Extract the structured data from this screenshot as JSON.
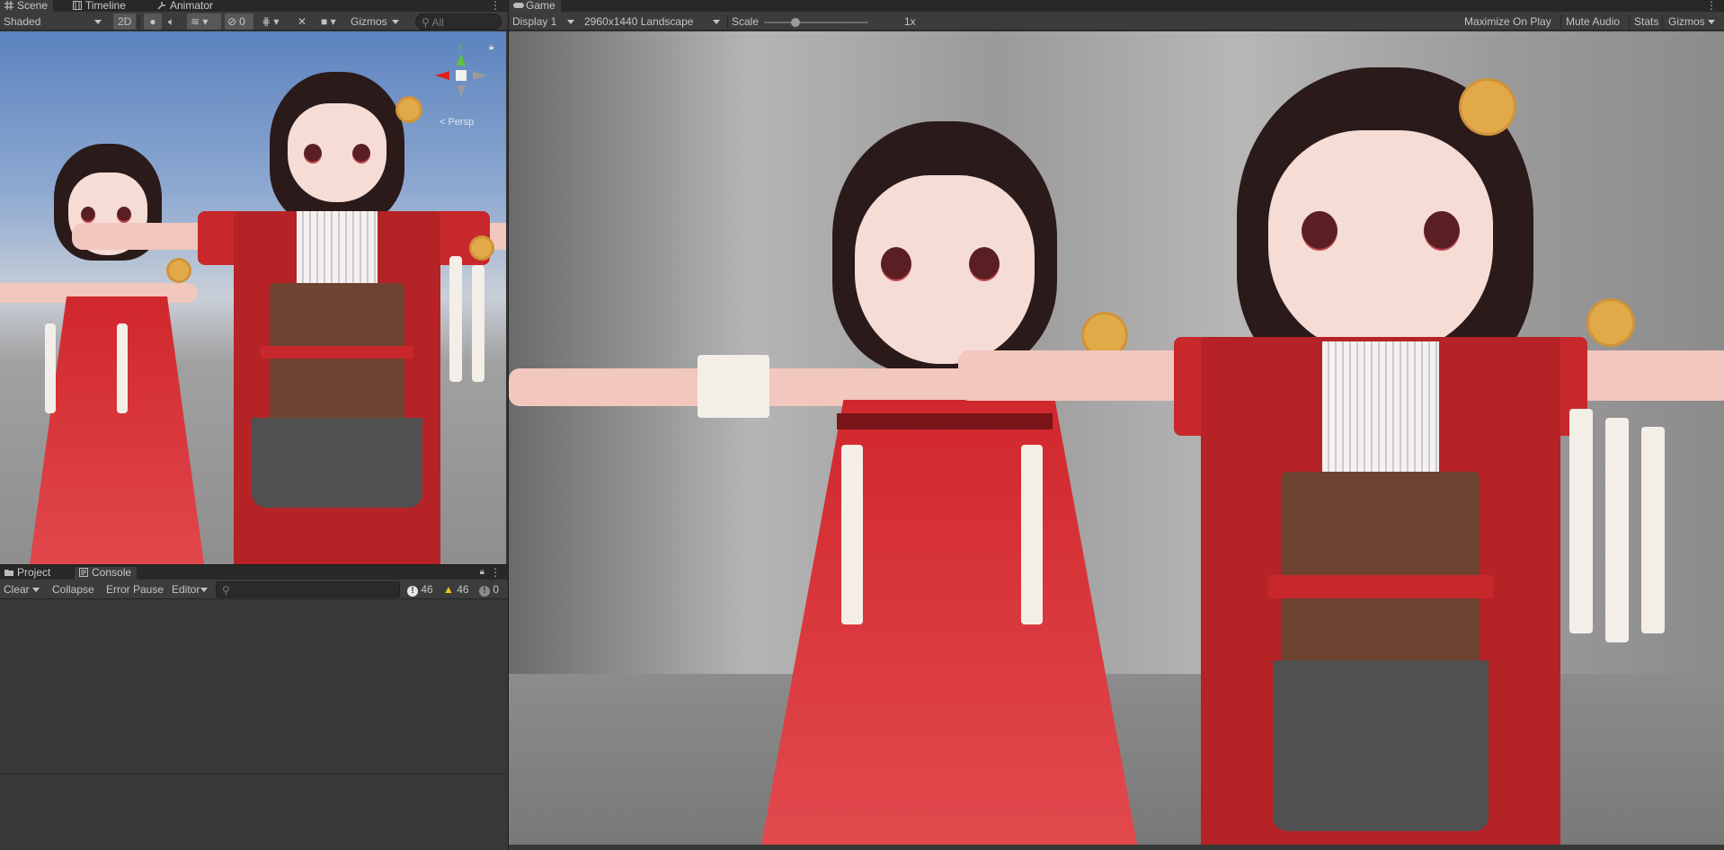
{
  "scene": {
    "tabs": [
      {
        "label": "Scene",
        "icon": "grid-icon"
      },
      {
        "label": "Timeline",
        "icon": "timeline-icon"
      },
      {
        "label": "Animator",
        "icon": "animator-icon"
      }
    ],
    "toolbar": {
      "shading_mode": "Shaded",
      "mode_2d": "2D",
      "hidden_count": "0",
      "gizmos": "Gizmos",
      "search_placeholder": "All"
    },
    "gizmo": {
      "y_label": "y",
      "persp_label": "< Persp"
    }
  },
  "game": {
    "tab": {
      "label": "Game",
      "icon": "gamepad-icon"
    },
    "toolbar": {
      "display": "Display 1",
      "resolution": "2960x1440 Landscape",
      "scale_label": "Scale",
      "scale_value": "1x",
      "scale_fraction": 0.3,
      "maximize": "Maximize On Play",
      "mute": "Mute Audio",
      "stats": "Stats",
      "gizmos": "Gizmos"
    }
  },
  "console": {
    "tabs": [
      {
        "label": "Project",
        "icon": "folder-icon"
      },
      {
        "label": "Console",
        "icon": "console-icon"
      }
    ],
    "toolbar": {
      "clear": "Clear",
      "collapse": "Collapse",
      "error_pause": "Error Pause",
      "editor": "Editor",
      "info_count": "46",
      "warning_count": "46",
      "error_count": "0"
    }
  },
  "colors": {
    "panel_bg": "#383838",
    "tabbar_bg": "#282828",
    "toolbar_bg": "#3c3c3c",
    "button_bg": "#585858",
    "warning": "#f0c419",
    "axis_x": "#e02020",
    "axis_y": "#62c13a"
  }
}
